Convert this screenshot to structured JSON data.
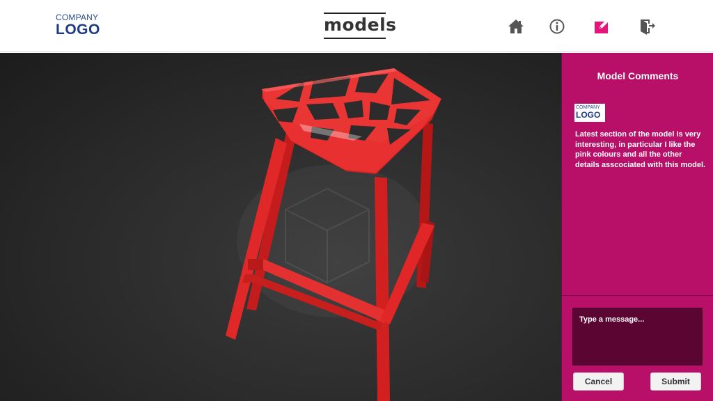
{
  "header": {
    "logo": {
      "line1": "COMPANY",
      "line2": "LOGO"
    },
    "title": "models",
    "nav": [
      {
        "name": "home-icon",
        "color": "#555555"
      },
      {
        "name": "info-icon",
        "color": "#555555"
      },
      {
        "name": "edit-icon",
        "color": "#e6147d",
        "active": true
      },
      {
        "name": "exit-icon",
        "color": "#555555"
      }
    ]
  },
  "viewer": {
    "model_color": "#e42a2a"
  },
  "comments": {
    "title": "Model Comments",
    "logo": {
      "line1": "COMPANY",
      "line2": "LOGO"
    },
    "text": "Latest section of the model is very interesting, in particular I like the pink colours and all the other details asscociated with this model.",
    "input_placeholder": "Type a message...",
    "cancel_label": "Cancel",
    "submit_label": "Submit",
    "panel_color": "#b80f68"
  }
}
